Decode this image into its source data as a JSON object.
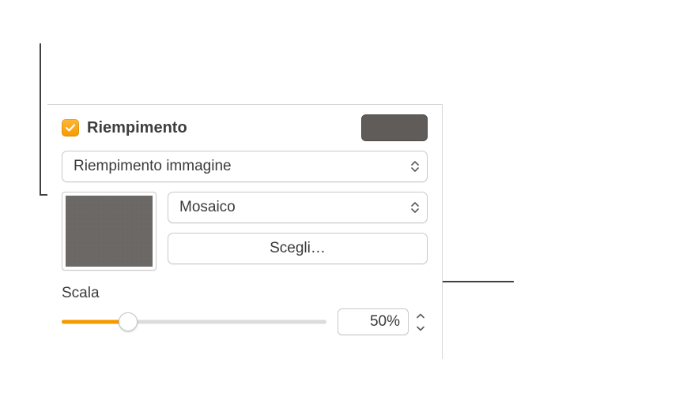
{
  "fill": {
    "checkbox_label": "Riempimento",
    "checked": true,
    "fill_type": {
      "selected": "Riempimento immagine"
    },
    "tiling": {
      "selected": "Mosaico"
    },
    "choose_button": "Scegli…",
    "color_swatch": "#5f5c5a",
    "image_swatch": "#6b6866"
  },
  "scale": {
    "label": "Scala",
    "value_pct": 50,
    "value_display": "50%",
    "slider_pos_pct": 25
  }
}
